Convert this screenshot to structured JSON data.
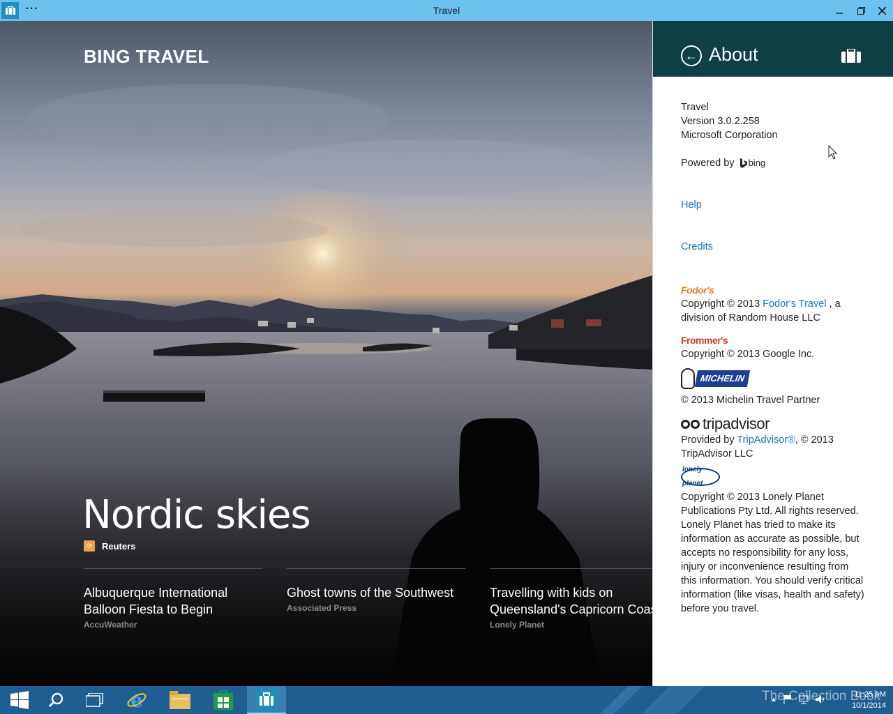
{
  "window": {
    "title": "Travel"
  },
  "hero": {
    "brand": "BING TRAVEL",
    "headline": "Nordic skies",
    "source": "Reuters",
    "stories": [
      {
        "title_line1": "Albuquerque International",
        "title_line2": "Balloon Fiesta to Begin",
        "source": "AccuWeather"
      },
      {
        "title_line1": "Ghost towns of the Southwest",
        "title_line2": "",
        "source": "Associated Press"
      },
      {
        "title_line1": "Travelling with kids on",
        "title_line2": "Queensland's Capricorn Coas",
        "source": "Lonely Planet"
      }
    ]
  },
  "about": {
    "header": "About",
    "app_name": "Travel",
    "version": "Version 3.0.2.258",
    "company": "Microsoft Corporation",
    "powered_by": "Powered by",
    "bing": "bing",
    "help": "Help",
    "credits": "Credits",
    "fodors": {
      "logo": "Fodor's",
      "pre": "Copyright © 2013 ",
      "link": "Fodor's Travel",
      "post": " , a division of Random House LLC"
    },
    "frommers": {
      "logo": "Frommer's",
      "text": "Copyright © 2013 Google Inc."
    },
    "michelin": {
      "logo": "MICHELIN",
      "text": "© 2013 Michelin Travel Partner"
    },
    "tripadvisor": {
      "logo": "tripadvisor",
      "pre": "Provided by ",
      "link": "TripAdvisor®",
      "post": ", © 2013 TripAdvisor LLC"
    },
    "lonelyplanet": {
      "logo": "lonely planet",
      "copyright": "Copyright © 2013 Lonely Planet Publications Pty Ltd. All rights reserved.",
      "disclaimer": "Lonely Planet has tried to make its information as accurate as possible, but accepts no responsibility for any loss, injury or inconvenience resulting from this information. You should verify critical information (like visas, health and safety) before you travel."
    }
  },
  "taskbar": {
    "time": "11:25 AM",
    "date": "10/1/2014",
    "watermark": "The Collection Book"
  },
  "colors": {
    "titlebar": "#6cc2ee",
    "pane_header": "#0e3f44",
    "link": "#1a73c6",
    "taskbar": "#1e5e91"
  }
}
